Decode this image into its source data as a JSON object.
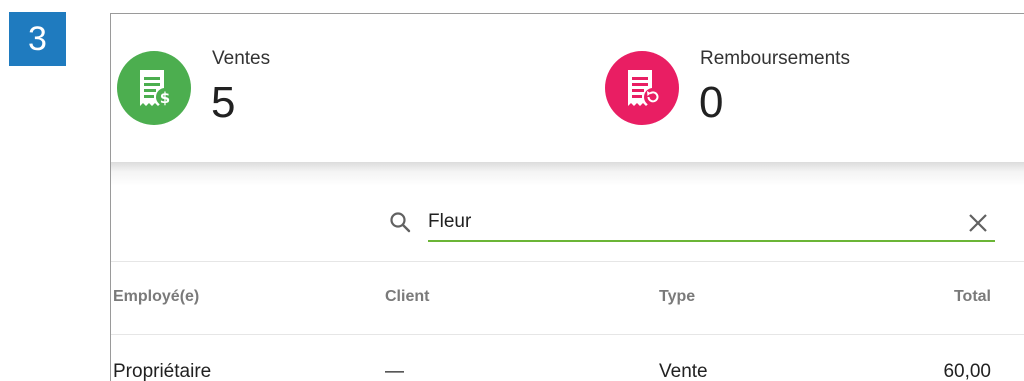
{
  "step_number": "3",
  "summary": {
    "sales": {
      "label": "Ventes",
      "value": "5",
      "color": "#4cae4f",
      "icon": "receipt-dollar-icon"
    },
    "refunds": {
      "label": "Remboursements",
      "value": "0",
      "color": "#e91e63",
      "icon": "receipt-refund-icon"
    }
  },
  "search": {
    "value": "Fleur",
    "placeholder": "",
    "accent": "#6bb536"
  },
  "table": {
    "headers": {
      "employee": "Employé(e)",
      "client": "Client",
      "type": "Type",
      "total": "Total"
    },
    "rows": [
      {
        "employee": "Propriétaire",
        "client": "—",
        "type": "Vente",
        "total": "60,00"
      }
    ]
  }
}
